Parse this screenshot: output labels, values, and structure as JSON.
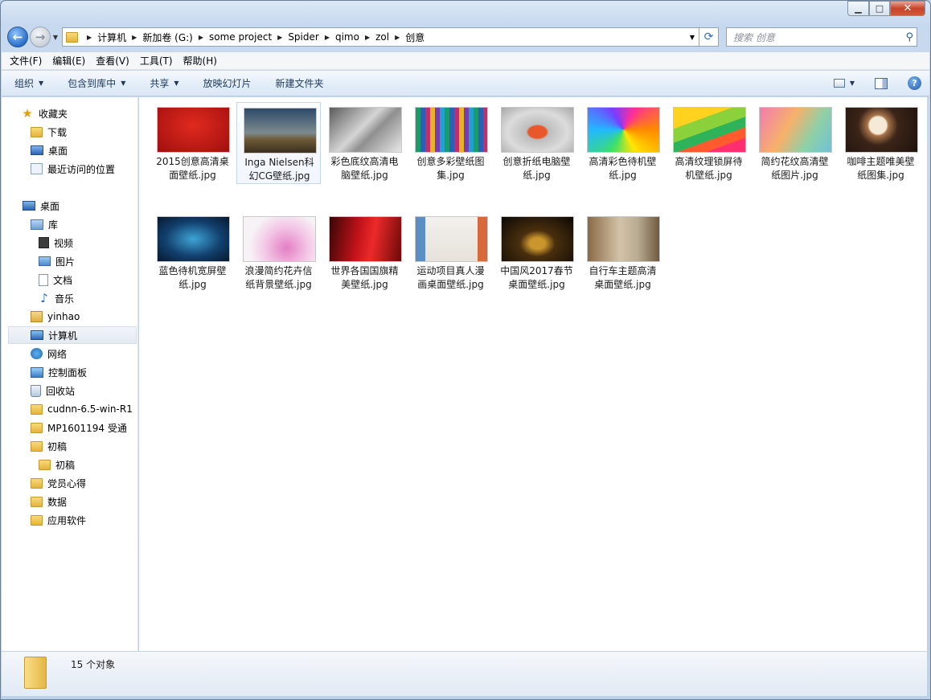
{
  "window": {
    "min_label": "▁",
    "max_label": "□",
    "close_label": "✕"
  },
  "address": {
    "crumbs": [
      "计算机",
      "新加卷 (G:)",
      "some project",
      "Spider",
      "qimo",
      "zol",
      "创意"
    ],
    "search_placeholder": "搜索 创意"
  },
  "menu": [
    "文件(F)",
    "编辑(E)",
    "查看(V)",
    "工具(T)",
    "帮助(H)"
  ],
  "commands": {
    "organize": "组织",
    "include": "包含到库中",
    "share": "共享",
    "slideshow": "放映幻灯片",
    "newfolder": "新建文件夹"
  },
  "nav": {
    "favorites": "收藏夹",
    "downloads": "下载",
    "desktop_fav": "桌面",
    "recent": "最近访问的位置",
    "desktop": "桌面",
    "libraries": "库",
    "videos": "视频",
    "pictures": "图片",
    "documents": "文档",
    "music": "音乐",
    "user": "yinhao",
    "computer": "计算机",
    "network": "网络",
    "control_panel": "控制面板",
    "recycle": "回收站",
    "cudnn": "cudnn-6.5-win-R1",
    "mp": "MP1601194 受通",
    "draft": "初稿",
    "draft_sub": "初稿",
    "party": "党员心得",
    "data": "数据",
    "apps": "应用软件"
  },
  "files": [
    {
      "name1": "2015创意高清桌",
      "name2": "面壁纸.jpg",
      "theme": "red"
    },
    {
      "name1": "Inga Nielsen科",
      "name2": "幻CG壁纸.jpg",
      "theme": "dusk"
    },
    {
      "name1": "彩色底纹高清电",
      "name2": "脑壁纸.jpg",
      "theme": "gray"
    },
    {
      "name1": "创意多彩壁纸图",
      "name2": "集.jpg",
      "theme": "stripes"
    },
    {
      "name1": "创意折纸电脑壁",
      "name2": "纸.jpg",
      "theme": "origami"
    },
    {
      "name1": "高清彩色待机壁",
      "name2": "纸.jpg",
      "theme": "poly"
    },
    {
      "name1": "高清纹理锁屏待",
      "name2": "机壁纸.jpg",
      "theme": "rainbow"
    },
    {
      "name1": "简约花纹高清壁",
      "name2": "纸图片.jpg",
      "theme": "pastel"
    },
    {
      "name1": "咖啡主题唯美壁",
      "name2": "纸图集.jpg",
      "theme": "coffee"
    },
    {
      "name1": "蓝色待机宽屏壁",
      "name2": "纸.jpg",
      "theme": "space"
    },
    {
      "name1": "浪漫简约花卉信",
      "name2": "纸背景壁纸.jpg",
      "theme": "flowers"
    },
    {
      "name1": "世界各国国旗精",
      "name2": "美壁纸.jpg",
      "theme": "flag"
    },
    {
      "name1": "运动项目真人漫",
      "name2": "画桌面壁纸.jpg",
      "theme": "sport"
    },
    {
      "name1": "中国风2017春节",
      "name2": "桌面壁纸.jpg",
      "theme": "newyear"
    },
    {
      "name1": "自行车主题高清",
      "name2": "桌面壁纸.jpg",
      "theme": "bike"
    }
  ],
  "status": {
    "count_text": "15 个对象"
  }
}
